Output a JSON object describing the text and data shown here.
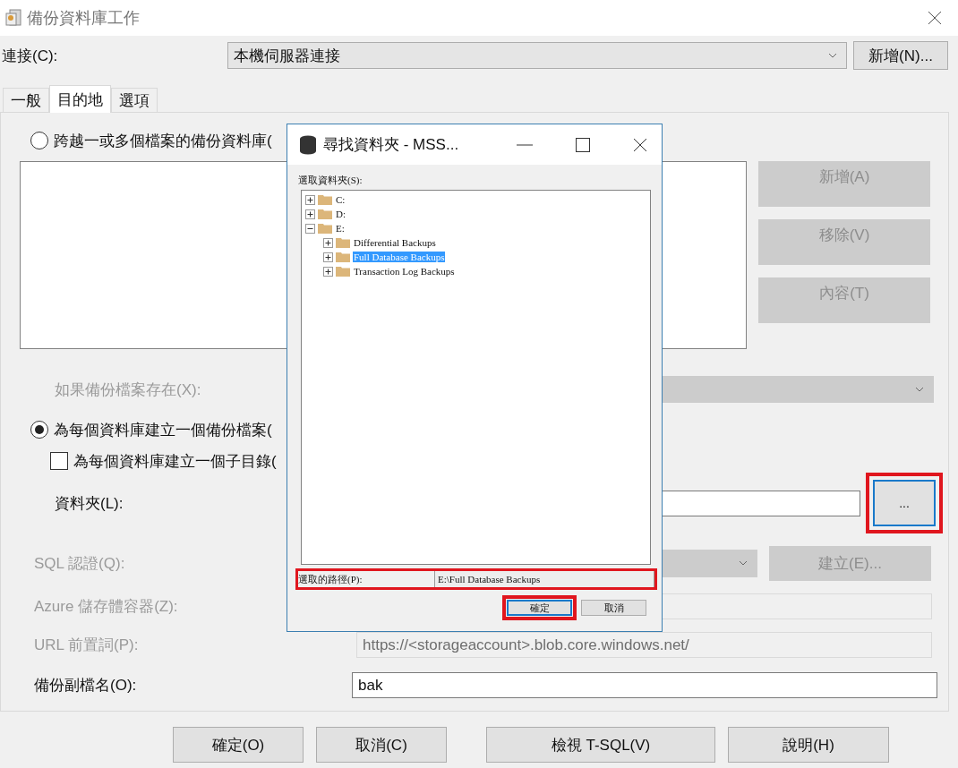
{
  "window": {
    "title": "備份資料庫工作"
  },
  "connection": {
    "label": "連接(C):",
    "value": "本機伺服器連接",
    "button": "新增(N)..."
  },
  "tabs": [
    {
      "label": "一般",
      "selected": false
    },
    {
      "label": "目的地",
      "selected": true
    },
    {
      "label": "選項",
      "selected": false
    }
  ],
  "span_files": {
    "label": "跨越一或多個檔案的備份資料庫(",
    "selected": false
  },
  "file_buttons": [
    {
      "label": "新增(A)",
      "disabled": true
    },
    {
      "label": "移除(V)",
      "disabled": true
    },
    {
      "label": "內容(T)",
      "disabled": true
    }
  ],
  "if_exists": {
    "label": "如果備份檔案存在(X):",
    "disabled": true
  },
  "per_database": {
    "label": "為每個資料庫建立一個備份檔案(",
    "selected": true
  },
  "subdirectory": {
    "label": "為每個資料庫建立一個子目錄(",
    "checked": false
  },
  "folder": {
    "label": "資料夾(L):",
    "browse_button": "...",
    "highlighted": true
  },
  "sql_credential": {
    "label": "SQL 認證(Q):",
    "button": "建立(E)...",
    "disabled": true
  },
  "azure_container": {
    "label": "Azure 儲存體容器(Z):",
    "disabled": true
  },
  "url_prefix": {
    "label": "URL 前置詞(P):",
    "value": "https://<storageaccount>.blob.core.windows.net/",
    "disabled": true
  },
  "extension": {
    "label": "備份副檔名(O):",
    "value": "bak",
    "disabled": false
  },
  "buttons": [
    "確定(O)",
    "取消(C)",
    "檢視 T-SQL(V)",
    "說明(H)"
  ],
  "browse_dialog": {
    "title": "尋找資料夾 - MSS...",
    "tree_label": "選取資料夾(S):",
    "tree": [
      {
        "label": "C:",
        "expanded": false,
        "selected": false
      },
      {
        "label": "D:",
        "expanded": false,
        "selected": false
      },
      {
        "label": "E:",
        "expanded": true,
        "selected": false,
        "children": [
          {
            "label": "Differential Backups",
            "expanded": false,
            "selected": false
          },
          {
            "label": "Full Database Backups",
            "expanded": false,
            "selected": true
          },
          {
            "label": "Transaction Log Backups",
            "expanded": false,
            "selected": false
          }
        ]
      }
    ],
    "path": {
      "label": "選取的路徑(P):",
      "value": "E:\\Full Database Backups",
      "highlighted": true
    },
    "buttons": [
      {
        "label": "確定",
        "default": true,
        "highlighted": true
      },
      {
        "label": "取消",
        "default": false,
        "highlighted": false
      }
    ]
  }
}
